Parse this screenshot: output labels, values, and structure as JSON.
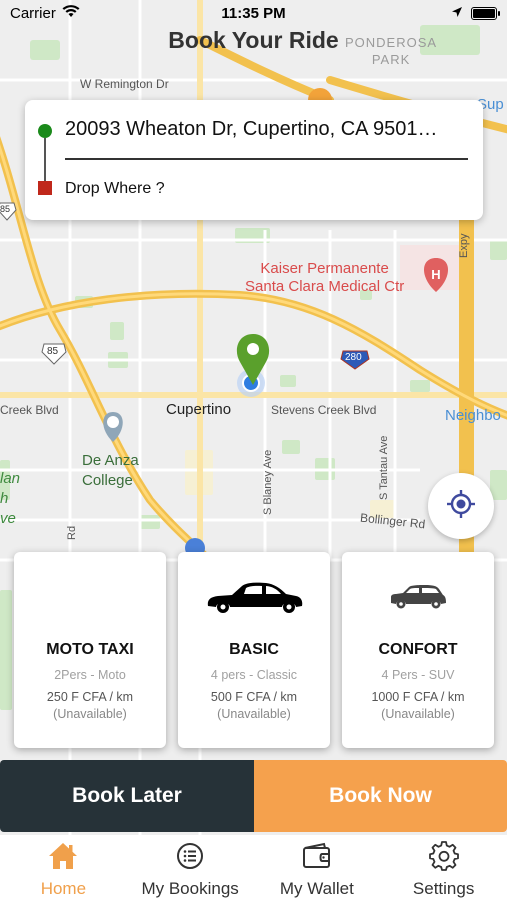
{
  "status_bar": {
    "carrier": "Carrier",
    "time": "11:35 PM"
  },
  "header": {
    "title": "Book Your Ride"
  },
  "map": {
    "labels": {
      "street_remington": "W Remington Dr",
      "park": "PONDEROSA\nPARK",
      "highway_85_a": "85",
      "highway_85_b": "85",
      "highway_280": "280",
      "hospital": "Kaiser Permanente\nSanta Clara Medical Ctr",
      "city": "Cupertino",
      "stevens_creek": "Stevens Creek Blvd",
      "creek_blvd": "Creek Blvd",
      "college": "De Anza\nCollege",
      "neighbor": "Neighbo",
      "sup": "Sup",
      "blaney": "S Blaney Ave",
      "tantau": "S Tantau Ave",
      "bollinger": "Bollinger Rd",
      "expy": "Expy",
      "rd": "Rd",
      "lan": "lan",
      "h": "h",
      "ve": "ve"
    }
  },
  "address": {
    "pickup": "20093 Wheaton Dr, Cupertino, CA 9501…",
    "drop_placeholder": "Drop Where ?"
  },
  "vehicles": [
    {
      "name": "MOTO TAXI",
      "description": "2Pers - Moto",
      "price": "250 F CFA / km",
      "status": "(Unavailable)"
    },
    {
      "name": "BASIC",
      "description": "4 pers - Classic",
      "price": "500 F CFA / km",
      "status": "(Unavailable)"
    },
    {
      "name": "CONFORT",
      "description": "4 Pers - SUV",
      "price": "1000 F CFA / km",
      "status": "(Unavailable)"
    }
  ],
  "actions": {
    "book_later": "Book Later",
    "book_now": "Book Now"
  },
  "tabs": [
    {
      "label": "Home",
      "icon": "home-icon",
      "active": true
    },
    {
      "label": "My Bookings",
      "icon": "list-icon",
      "active": false
    },
    {
      "label": "My Wallet",
      "icon": "wallet-icon",
      "active": false
    },
    {
      "label": "Settings",
      "icon": "gear-icon",
      "active": false
    }
  ],
  "colors": {
    "accent": "#f5a14d",
    "dark_button": "#263238",
    "pickup_green": "#1b8a1b",
    "drop_red": "#c0281b",
    "map_pin_green": "#5aa02c",
    "road_yellow": "#f7c95c"
  }
}
